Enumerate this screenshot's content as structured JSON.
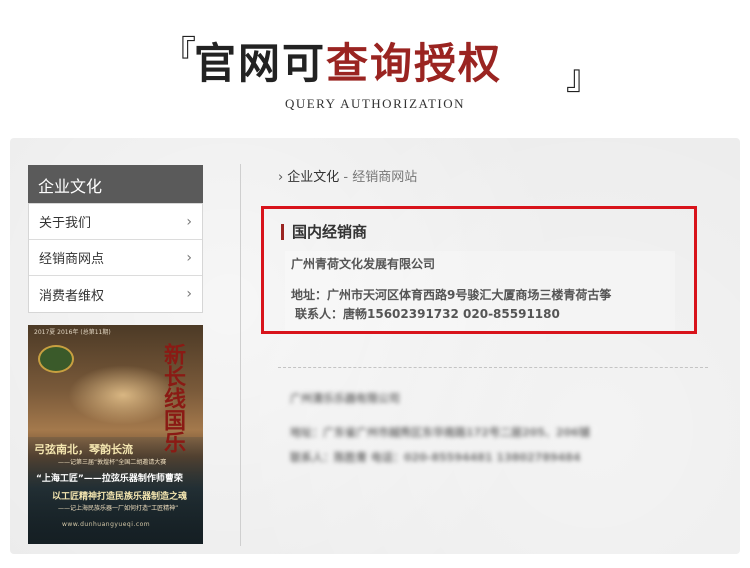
{
  "header": {
    "bracket_left": "『",
    "bracket_right": "』",
    "title_dark": "官网可",
    "title_red": "查询授权",
    "subtitle": "QUERY AUTHORIZATION",
    "colors": {
      "red": "#9a2421",
      "dark": "#222222"
    }
  },
  "sidebar": {
    "title": "企业文化",
    "items": [
      {
        "label": "关于我们",
        "icon": "chevron-right-icon"
      },
      {
        "label": "经销商网点",
        "icon": "chevron-right-icon"
      },
      {
        "label": "消费者维权",
        "icon": "chevron-right-icon"
      }
    ]
  },
  "magazine": {
    "issue": "2017夏 2016年 (总第11期)",
    "calligraphy": "新长线国乐",
    "headline1": "弓弦南北，琴韵长流",
    "line1": "——记第三届“敦煌杯”全国二胡邀请大赛",
    "headline2": "“上海工匠”——拉弦乐器制作师曹荣",
    "headline3": "以工匠精神打造民族乐器制造之魂",
    "line2": "——记上海民族乐器一厂如何打造“工匠精神”",
    "url": "www.dunhuangyueqi.com"
  },
  "breadcrumb": {
    "arrow": "›",
    "parent": "企业文化",
    "separator": " - ",
    "current": "经销商网站"
  },
  "dealer": {
    "section_title": "国内经销商",
    "company": "广州青荷文化发展有限公司",
    "address": "地址：广州市天河区体育西路9号骏汇大厦商场三楼青荷古筝",
    "contact": "联系人：唐畅15602391732  020-85591180",
    "highlight_color": "#d8131b"
  },
  "blurred_dealer": {
    "company": "广州清乐乐器有限公司",
    "address": "地址：广东省广州市越秀区东华南路172号二层205、206铺",
    "contact": "联系人：陈胜青 电话：020-85594481  13802789484"
  }
}
